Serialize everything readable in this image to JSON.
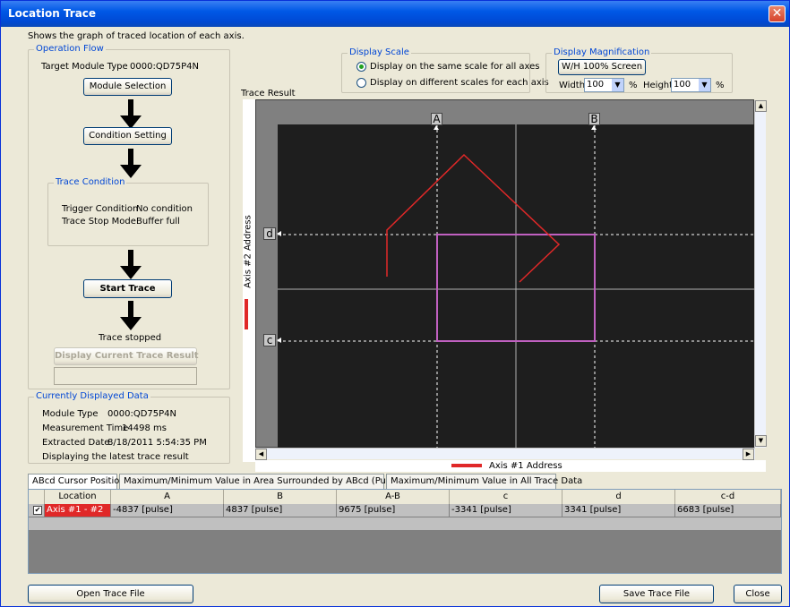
{
  "window": {
    "title": "Location Trace",
    "close_glyph": "✕"
  },
  "description": "Shows the graph of traced location of each axis.",
  "operation_flow": {
    "legend": "Operation Flow",
    "target_module_label": "Target Module Type",
    "target_module_value": "0000:QD75P4N",
    "module_selection_button": "Module Selection",
    "condition_setting_button": "Condition Setting",
    "trace_condition": {
      "legend": "Trace Condition",
      "trigger_label": "Trigger Condition",
      "trigger_value": "No condition",
      "stop_mode_label": "Trace Stop Mode",
      "stop_mode_value": "Buffer full"
    },
    "start_trace_button": "Start Trace",
    "status": "Trace stopped",
    "display_current_button": "Display Current Trace Result"
  },
  "current_data": {
    "legend": "Currently Displayed Data",
    "module_type_label": "Module Type",
    "module_type_value": "0000:QD75P4N",
    "measurement_label": "Measurement Time",
    "measurement_value": "14498 ms",
    "extracted_label": "Extracted Date",
    "extracted_value": "8/18/2011 5:54:35 PM",
    "note": "Displaying the latest trace result"
  },
  "display_scale": {
    "legend": "Display Scale",
    "option_same": "Display on the same scale for all axes",
    "option_different": "Display on different scales for each axis",
    "selected": "same"
  },
  "display_magnification": {
    "legend": "Display Magnification",
    "wh_button": "W/H 100% Screen",
    "width_label": "Width",
    "width_value": "100",
    "height_label": "Height",
    "height_value": "100",
    "unit": "%"
  },
  "plot": {
    "title": "Trace Result",
    "y_axis_label": "Axis #2 Address",
    "x_axis_label": "Axis #1 Address",
    "cursor_a": "A",
    "cursor_b": "B",
    "cursor_c": "c",
    "cursor_d": "d",
    "trace_color": "#e02828",
    "box_color": "#c060c0"
  },
  "tabs": [
    "ABcd Cursor Position",
    "Maximum/Minimum Value in Area Surrounded by ABcd (Purple Box)",
    "Maximum/Minimum Value in All Trace Data"
  ],
  "table": {
    "columns": [
      "Location",
      "A",
      "B",
      "A-B",
      "c",
      "d",
      "c-d"
    ],
    "rows": [
      {
        "checked": true,
        "location": "Axis #1 - #2",
        "A": "-4837 [pulse]",
        "B": "4837 [pulse]",
        "A-B": "9675 [pulse]",
        "c": "-3341 [pulse]",
        "d": "3341 [pulse]",
        "c-d": "6683 [pulse]"
      }
    ]
  },
  "footer": {
    "open_button": "Open Trace File",
    "save_button": "Save Trace File",
    "close_button": "Close"
  }
}
